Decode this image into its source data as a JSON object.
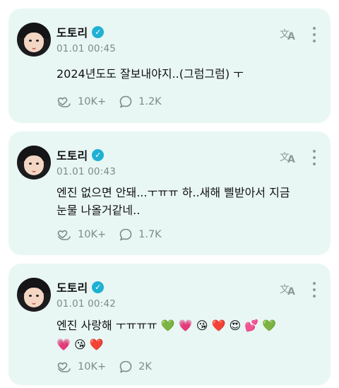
{
  "posts": [
    {
      "author": "도토리",
      "date": "01.01 00:45",
      "text": "2024년도도 잘보내야지..(그럼그럼) ㅜ",
      "likes": "10K+",
      "comments": "1.2K"
    },
    {
      "author": "도토리",
      "date": "01.01 00:43",
      "text": "엔진 없으면 안돼...ㅜㅠㅠ 하..새해 삘받아서 지금\n눈물 나올거같네..",
      "likes": "10K+",
      "comments": "1.7K"
    },
    {
      "author": "도토리",
      "date": "01.01 00:42",
      "text": "엔진 사랑해 ㅜㅠㅠㅠ 💚 💗 😘 ❤️ 😍 💕 💚\n💗 😘 ❤️",
      "likes": "10K+",
      "comments": "2K"
    }
  ],
  "icons": {
    "verified": "verified-badge-icon",
    "translate": "translate-icon",
    "more": "more-vertical-icon",
    "like": "heart-hands-icon",
    "comment": "comment-bubble-icon"
  },
  "colors": {
    "card_background": "#e8f7f4",
    "verified": "#1fb1d3",
    "muted": "#7f8a88"
  }
}
